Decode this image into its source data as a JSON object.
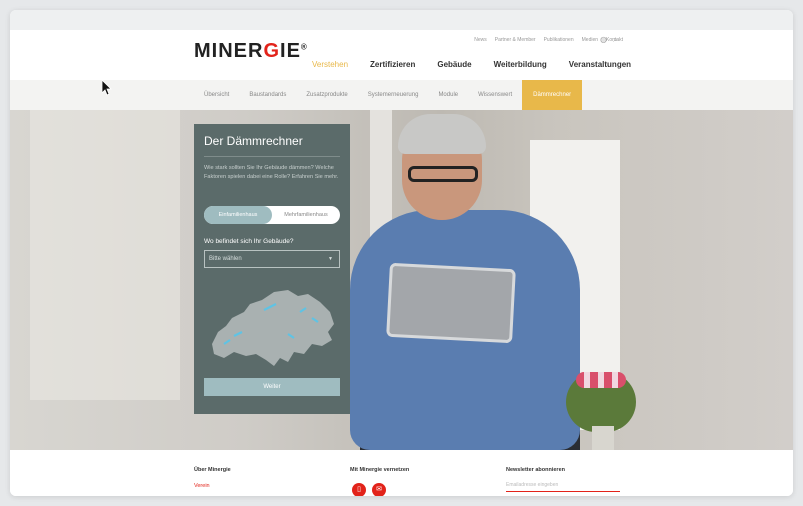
{
  "brand": {
    "logo_text_a": "MINER",
    "logo_text_g": "G",
    "logo_text_b": "IE",
    "registered": "®"
  },
  "meta_nav": [
    "News",
    "Partner & Member",
    "Publikationen",
    "Medien",
    "Kontakt"
  ],
  "meta_icons": [
    "globe-icon",
    "search-icon"
  ],
  "main_nav": [
    {
      "label": "Verstehen",
      "active": true
    },
    {
      "label": "Zertifizieren",
      "active": false
    },
    {
      "label": "Gebäude",
      "active": false
    },
    {
      "label": "Weiterbildung",
      "active": false
    },
    {
      "label": "Veranstaltungen",
      "active": false
    }
  ],
  "sub_nav": [
    {
      "label": "Übersicht",
      "active": false
    },
    {
      "label": "Baustandards",
      "active": false
    },
    {
      "label": "Zusatzprodukte",
      "active": false
    },
    {
      "label": "Systemerneuerung",
      "active": false
    },
    {
      "label": "Module",
      "active": false
    },
    {
      "label": "Wissenswert",
      "active": false
    },
    {
      "label": "Dämmrechner",
      "active": true
    }
  ],
  "calculator": {
    "title": "Der Dämmrechner",
    "description": "Wie stark sollten Sie Ihr Gebäude dämmen? Welche Faktoren spielen dabei eine Rolle? Erfahren Sie mehr.",
    "toggle_options": [
      "Einfamilienhaus",
      "Mehrfamilienhaus"
    ],
    "toggle_selected": "Einfamilienhaus",
    "question": "Wo befindet sich Ihr Gebäude?",
    "select_value": "Bitte wählen",
    "button_label": "Weiter"
  },
  "footer": {
    "col1_title": "Über Minergie",
    "col1_link": "Verein",
    "col2_title": "Mit Minergie vernetzen",
    "col3_title": "Newsletter abonnieren",
    "email_placeholder": "Emailadresse eingeben"
  },
  "colors": {
    "accent": "#e8b84a",
    "brand_red": "#e2231a",
    "panel": "#5b6b6a",
    "toggle": "#9fbcc0"
  }
}
